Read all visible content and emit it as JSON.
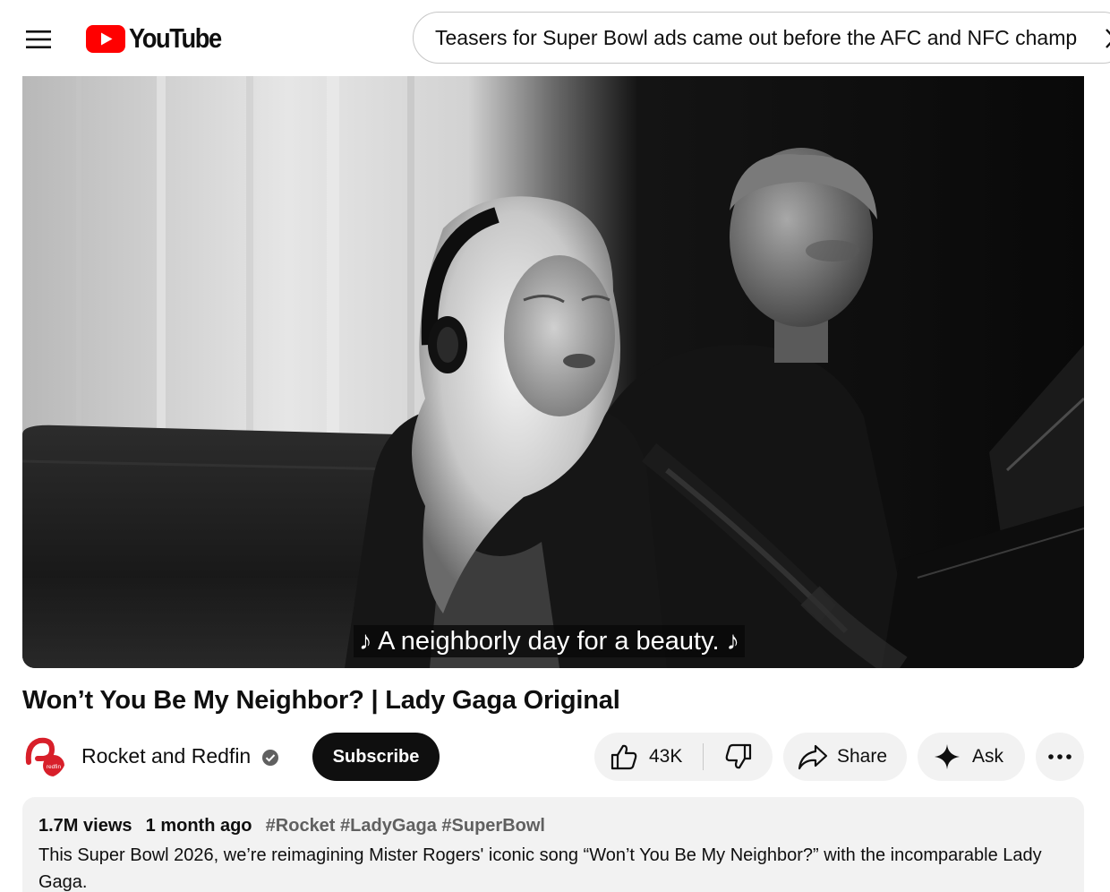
{
  "header": {
    "logo_text": "YouTube",
    "search": {
      "value": "Teasers for Super Bowl ads came out before the AFC and NFC champ",
      "clear_icon": "close-icon"
    },
    "brand_color": "#ff0000"
  },
  "player": {
    "caption": "♪ A neighborly day for a beauty. ♪"
  },
  "video": {
    "title": "Won’t You Be My Neighbor? | Lady Gaga Original"
  },
  "owner": {
    "channel_name": "Rocket and Redfin",
    "avatar_text": "redfin",
    "verified_icon": "verified-check-icon",
    "subscribe_label": "Subscribe"
  },
  "actions": {
    "like_count": "43K",
    "like_icon": "thumbs-up-icon",
    "dislike_icon": "thumbs-down-icon",
    "share_label": "Share",
    "share_icon": "share-arrow-icon",
    "ask_label": "Ask",
    "ask_icon": "sparkle-icon",
    "more_icon": "more-horizontal-icon"
  },
  "description": {
    "views": "1.7M views",
    "date": "1 month ago",
    "hashtags": "#Rocket #LadyGaga #SuperBowl",
    "text": "This Super Bowl 2026, we’re reimagining Mister Rogers' iconic song “Won’t You Be My Neighbor?” with the incomparable Lady Gaga."
  }
}
